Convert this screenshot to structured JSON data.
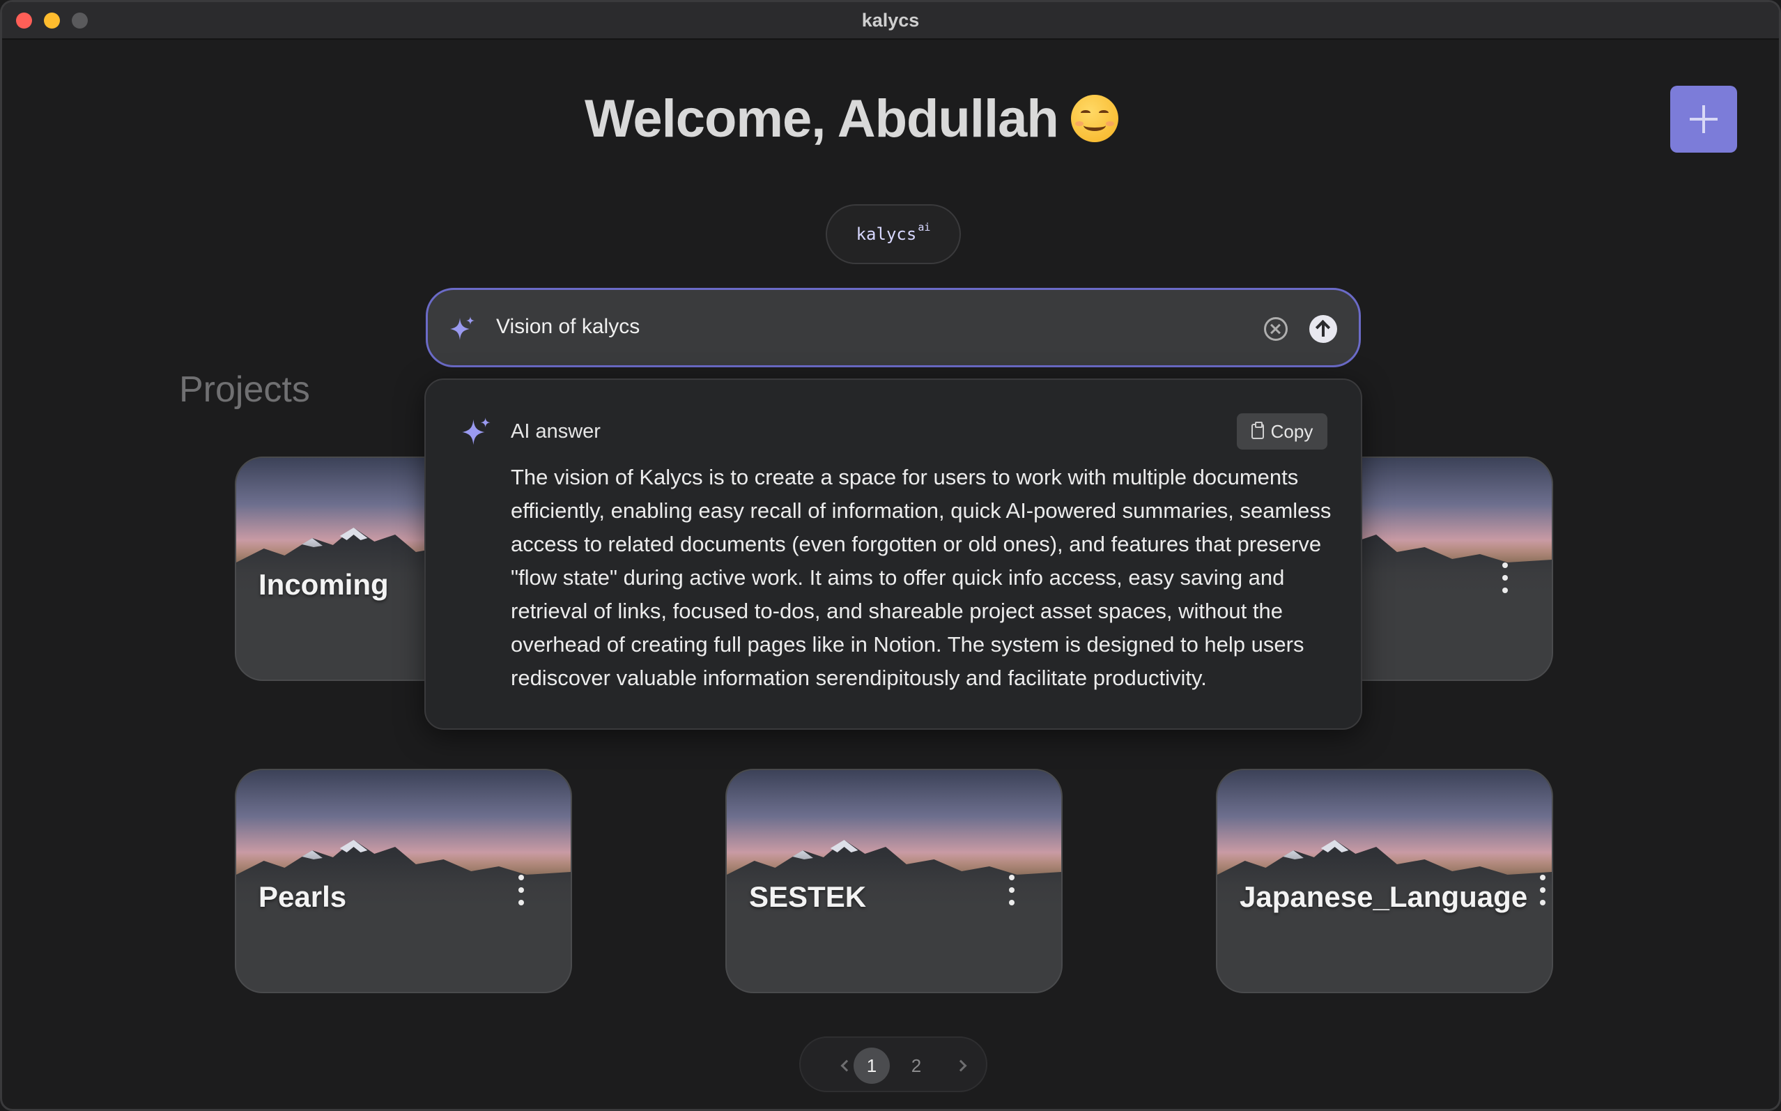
{
  "window": {
    "title": "kalycs"
  },
  "header": {
    "welcome": "Welcome, Abdullah",
    "emoji": "smiling-face-icon",
    "add_button": "plus-icon"
  },
  "kalycs_pill": {
    "name": "kalycs",
    "sup": "ai"
  },
  "search": {
    "value": "Vision of kalycs",
    "icons": [
      "sparkle-icon",
      "clear-icon",
      "send-arrow-icon"
    ]
  },
  "projects": {
    "title": "Projects",
    "cards": [
      {
        "title": "Incoming"
      },
      {
        "title": ""
      },
      {
        "title": "Pearls"
      },
      {
        "title": "SESTEK"
      },
      {
        "title": "Japanese_Language"
      }
    ]
  },
  "ai_answer": {
    "label": "AI answer",
    "copy_label": "Copy",
    "text": "The vision of Kalycs is to create a space for users to work with multiple documents efficiently, enabling easy recall of information, quick AI-powered summaries, seamless access to related documents (even forgotten or old ones), and features that preserve \"flow state\" during active work. It aims to offer quick info access, easy saving and retrieval of links, focused to-dos, and shareable project asset spaces, without the overhead of creating full pages like in Notion. The system is designed to help users rediscover valuable information serendipitously and facilitate productivity."
  },
  "pagination": {
    "pages": [
      "1",
      "2"
    ],
    "current": "1"
  },
  "colors": {
    "accent": "#7c7cd9",
    "search_border": "#6b6bc8",
    "background": "#1c1c1d",
    "card": "#3d3e40"
  }
}
